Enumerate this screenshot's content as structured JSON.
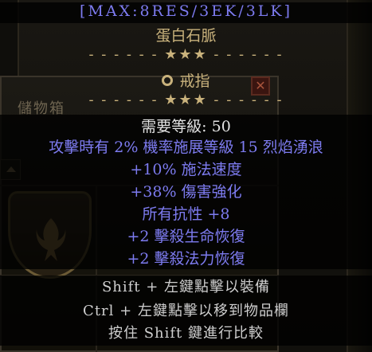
{
  "stash": {
    "title": "儲物箱",
    "close_glyph": "✕"
  },
  "tooltip": {
    "header": "[MAX:8RES/3EK/3LK]",
    "item_name": "蛋白石脈",
    "stars_top": "- - - - - - ★★★ - - - - - -",
    "item_type": "戒指",
    "item_type_icon": "ring-icon",
    "stars_bottom": "- - - - - - ★★★ - - - - - -",
    "required_level_label": "需要等級:",
    "required_level_value": "50",
    "mods": [
      "攻擊時有 2% 機率施展等級 15 烈焰湧浪",
      "+10% 施法速度",
      "+38% 傷害強化",
      "所有抗性 +8",
      "+2 擊殺生命恢復",
      "+2 擊殺法力恢復"
    ],
    "hints": [
      "Shift + 左鍵點擊以裝備",
      "Ctrl + 左鍵點擊以移到物品欄",
      "按住 Shift 鍵進行比較"
    ]
  },
  "colors": {
    "magic_blue": "#7d7bf0",
    "unique_gold": "#c9b27c",
    "white": "#e3e3e3"
  }
}
